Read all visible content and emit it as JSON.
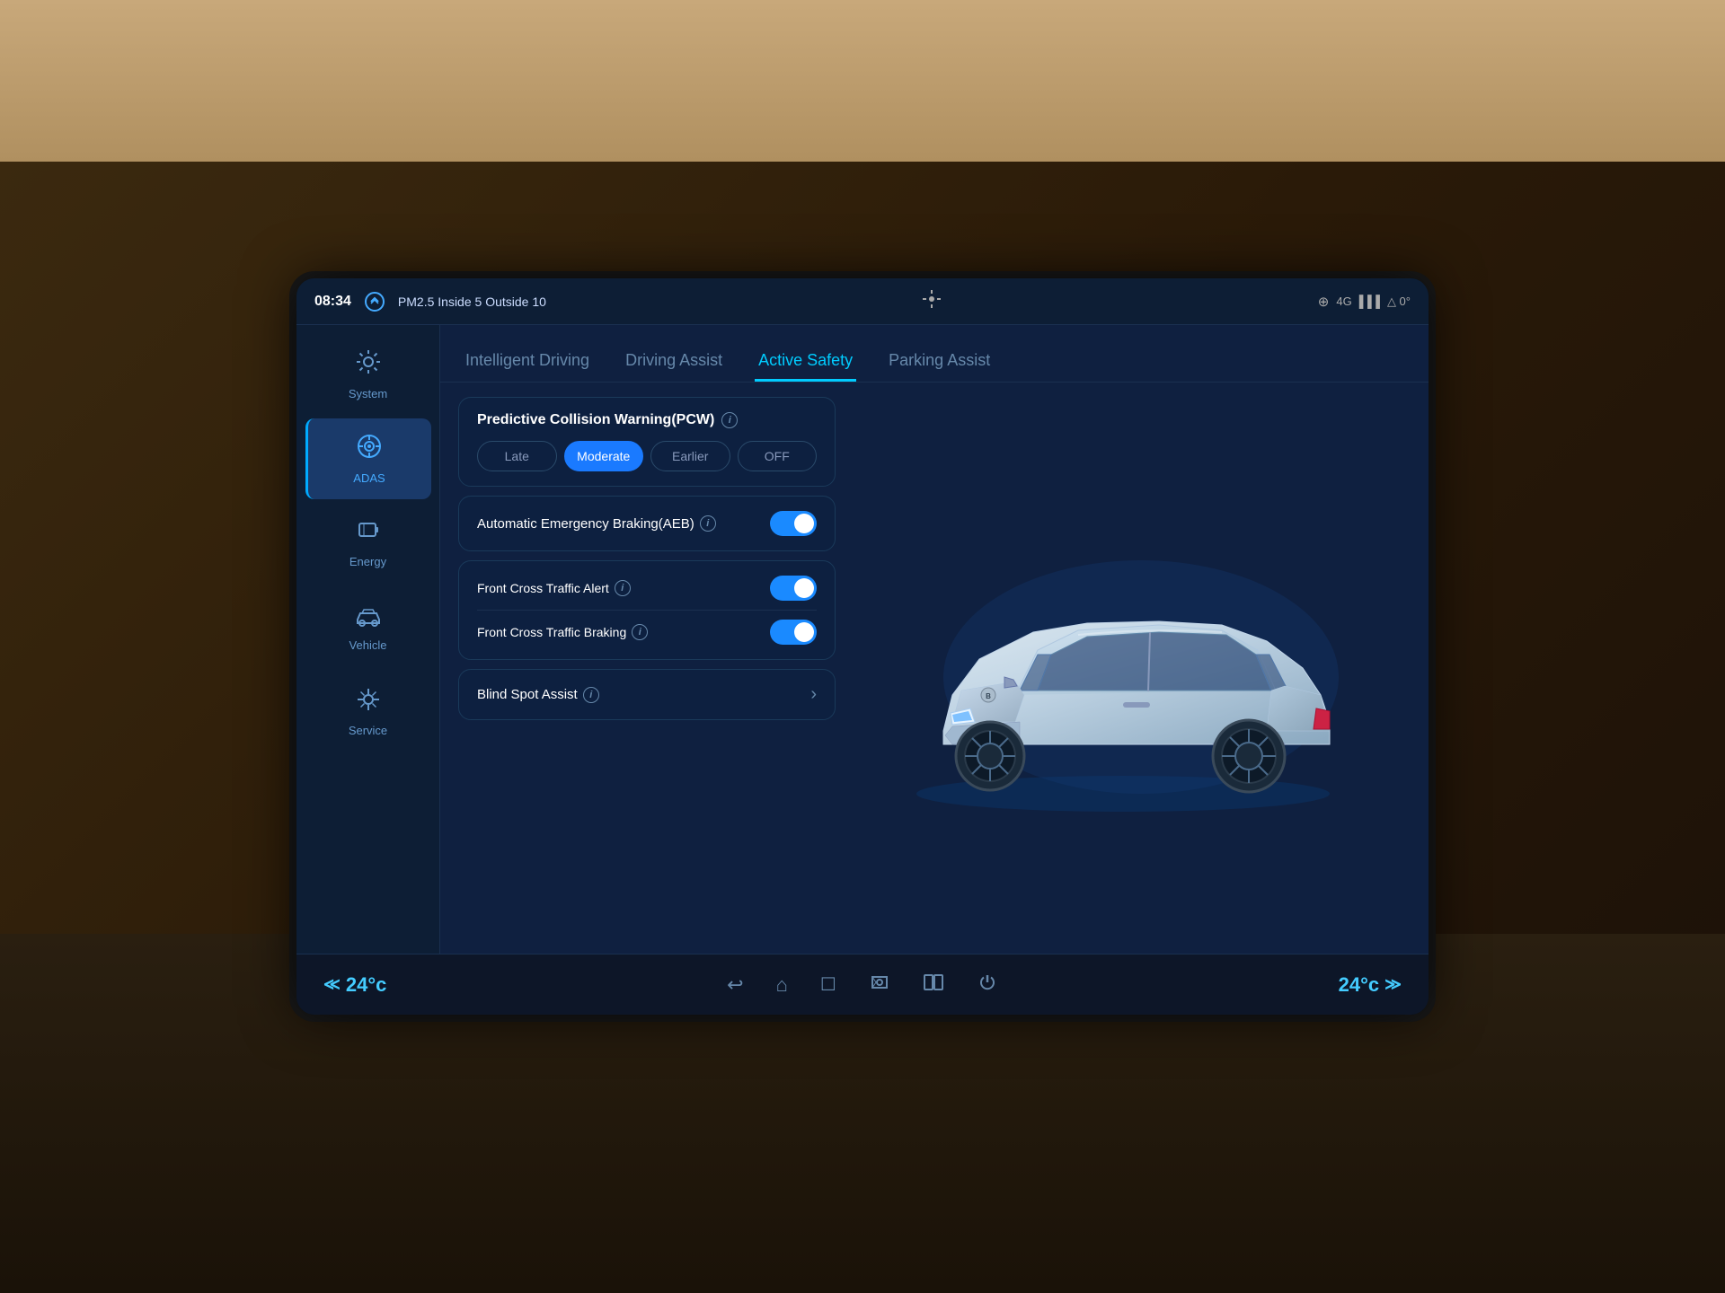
{
  "statusBar": {
    "time": "08:34",
    "pm_label": "PM2.5 Inside 5 Outside 10",
    "right_icons": "⊕ 4G ▲0°"
  },
  "sidebar": {
    "items": [
      {
        "id": "system",
        "label": "System",
        "icon": "⚙",
        "active": false
      },
      {
        "id": "adas",
        "label": "ADAS",
        "icon": "◉",
        "active": true
      },
      {
        "id": "energy",
        "label": "Energy",
        "icon": "⚡",
        "active": false
      },
      {
        "id": "vehicle",
        "label": "Vehicle",
        "icon": "🚗",
        "active": false
      },
      {
        "id": "service",
        "label": "Service",
        "icon": "🔧",
        "active": false
      }
    ]
  },
  "tabs": [
    {
      "id": "intelligent-driving",
      "label": "Intelligent Driving",
      "active": false
    },
    {
      "id": "driving-assist",
      "label": "Driving Assist",
      "active": false
    },
    {
      "id": "active-safety",
      "label": "Active Safety",
      "active": true
    },
    {
      "id": "parking-assist",
      "label": "Parking Assist",
      "active": false
    }
  ],
  "cards": {
    "pcw": {
      "title": "Predictive Collision Warning(PCW)",
      "options": [
        {
          "id": "late",
          "label": "Late",
          "active": false
        },
        {
          "id": "moderate",
          "label": "Moderate",
          "active": true
        },
        {
          "id": "earlier",
          "label": "Earlier",
          "active": false
        },
        {
          "id": "off",
          "label": "OFF",
          "active": false
        }
      ]
    },
    "aeb": {
      "title": "Automatic Emergency Braking(AEB)",
      "toggle": true
    },
    "frontCross": {
      "alert_title": "Front Cross Traffic Alert",
      "alert_toggle": true,
      "braking_title": "Front Cross Traffic Braking",
      "braking_toggle": true
    },
    "blindSpot": {
      "title": "Blind Spot Assist"
    }
  },
  "bottomBar": {
    "temp_left": "24°c",
    "temp_right": "24°c",
    "nav_icons": [
      "↩",
      "⌂",
      "□",
      "🔄",
      "⊞",
      "⏻"
    ]
  },
  "colors": {
    "accent": "#00ccff",
    "toggle_on": "#1a8aff",
    "active_tab": "#00ccff",
    "bg_main": "#0f2040",
    "sidebar_active": "#1a3a6a"
  }
}
